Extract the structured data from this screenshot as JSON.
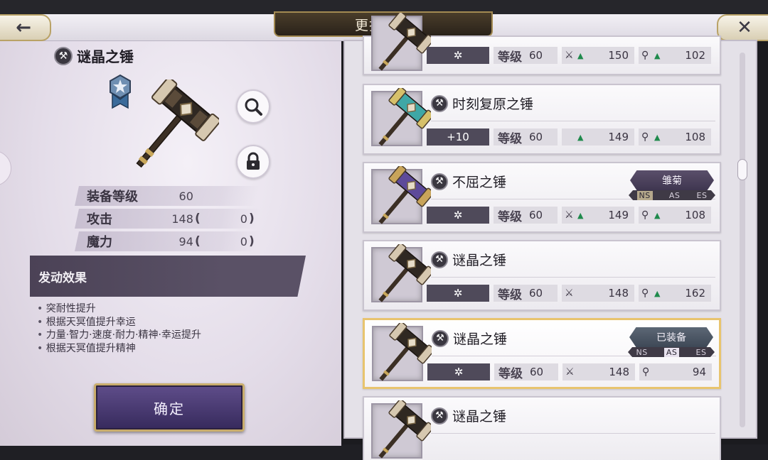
{
  "header": {
    "title": "更换装备",
    "back_icon": "←",
    "close_icon": "✕"
  },
  "detail": {
    "name": "谜晶之锤",
    "stats": [
      {
        "label": "装备等级",
        "value": "60",
        "bonus": null
      },
      {
        "label": "攻击",
        "value": "148",
        "bonus": "0"
      },
      {
        "label": "魔力",
        "value": "94",
        "bonus": "0"
      }
    ],
    "effect_title": "发动效果",
    "effects": [
      "突耐性提升",
      "根据天冥值提升幸运",
      "力量·智力·速度·耐力·精神·幸运提升",
      "根据天冥值提升精神"
    ],
    "confirm_label": "确定"
  },
  "list": [
    {
      "name": "",
      "plus": "✲",
      "level_label": "等级",
      "level": "60",
      "atk": "150",
      "atk_up": true,
      "mag": "102",
      "mag_up": true,
      "tag": null
    },
    {
      "name": "时刻复原之锤",
      "plus": "+10",
      "level_label": "等级",
      "level": "60",
      "atk": "149",
      "atk_up": true,
      "mag": "108",
      "mag_up": true,
      "tag": null
    },
    {
      "name": "不屈之锤",
      "plus": "✲",
      "level_label": "等级",
      "level": "60",
      "atk": "149",
      "atk_up": true,
      "mag": "108",
      "mag_up": true,
      "tag": "雏菊",
      "ns": [
        "NS",
        "AS",
        "ES"
      ]
    },
    {
      "name": "谜晶之锤",
      "plus": "✲",
      "level_label": "等级",
      "level": "60",
      "atk": "148",
      "atk_up": false,
      "mag": "162",
      "mag_up": true,
      "tag": null
    },
    {
      "name": "谜晶之锤",
      "plus": "✲",
      "level_label": "等级",
      "level": "60",
      "atk": "148",
      "atk_up": false,
      "mag": "94",
      "mag_up": false,
      "tag": "已装备",
      "ns": [
        "NS",
        "AS",
        "ES"
      ]
    },
    {
      "name": "谜晶之锤",
      "plus": "",
      "level_label": "",
      "level": "",
      "atk": "",
      "atk_up": false,
      "mag": "",
      "mag_up": false,
      "tag": null
    }
  ]
}
